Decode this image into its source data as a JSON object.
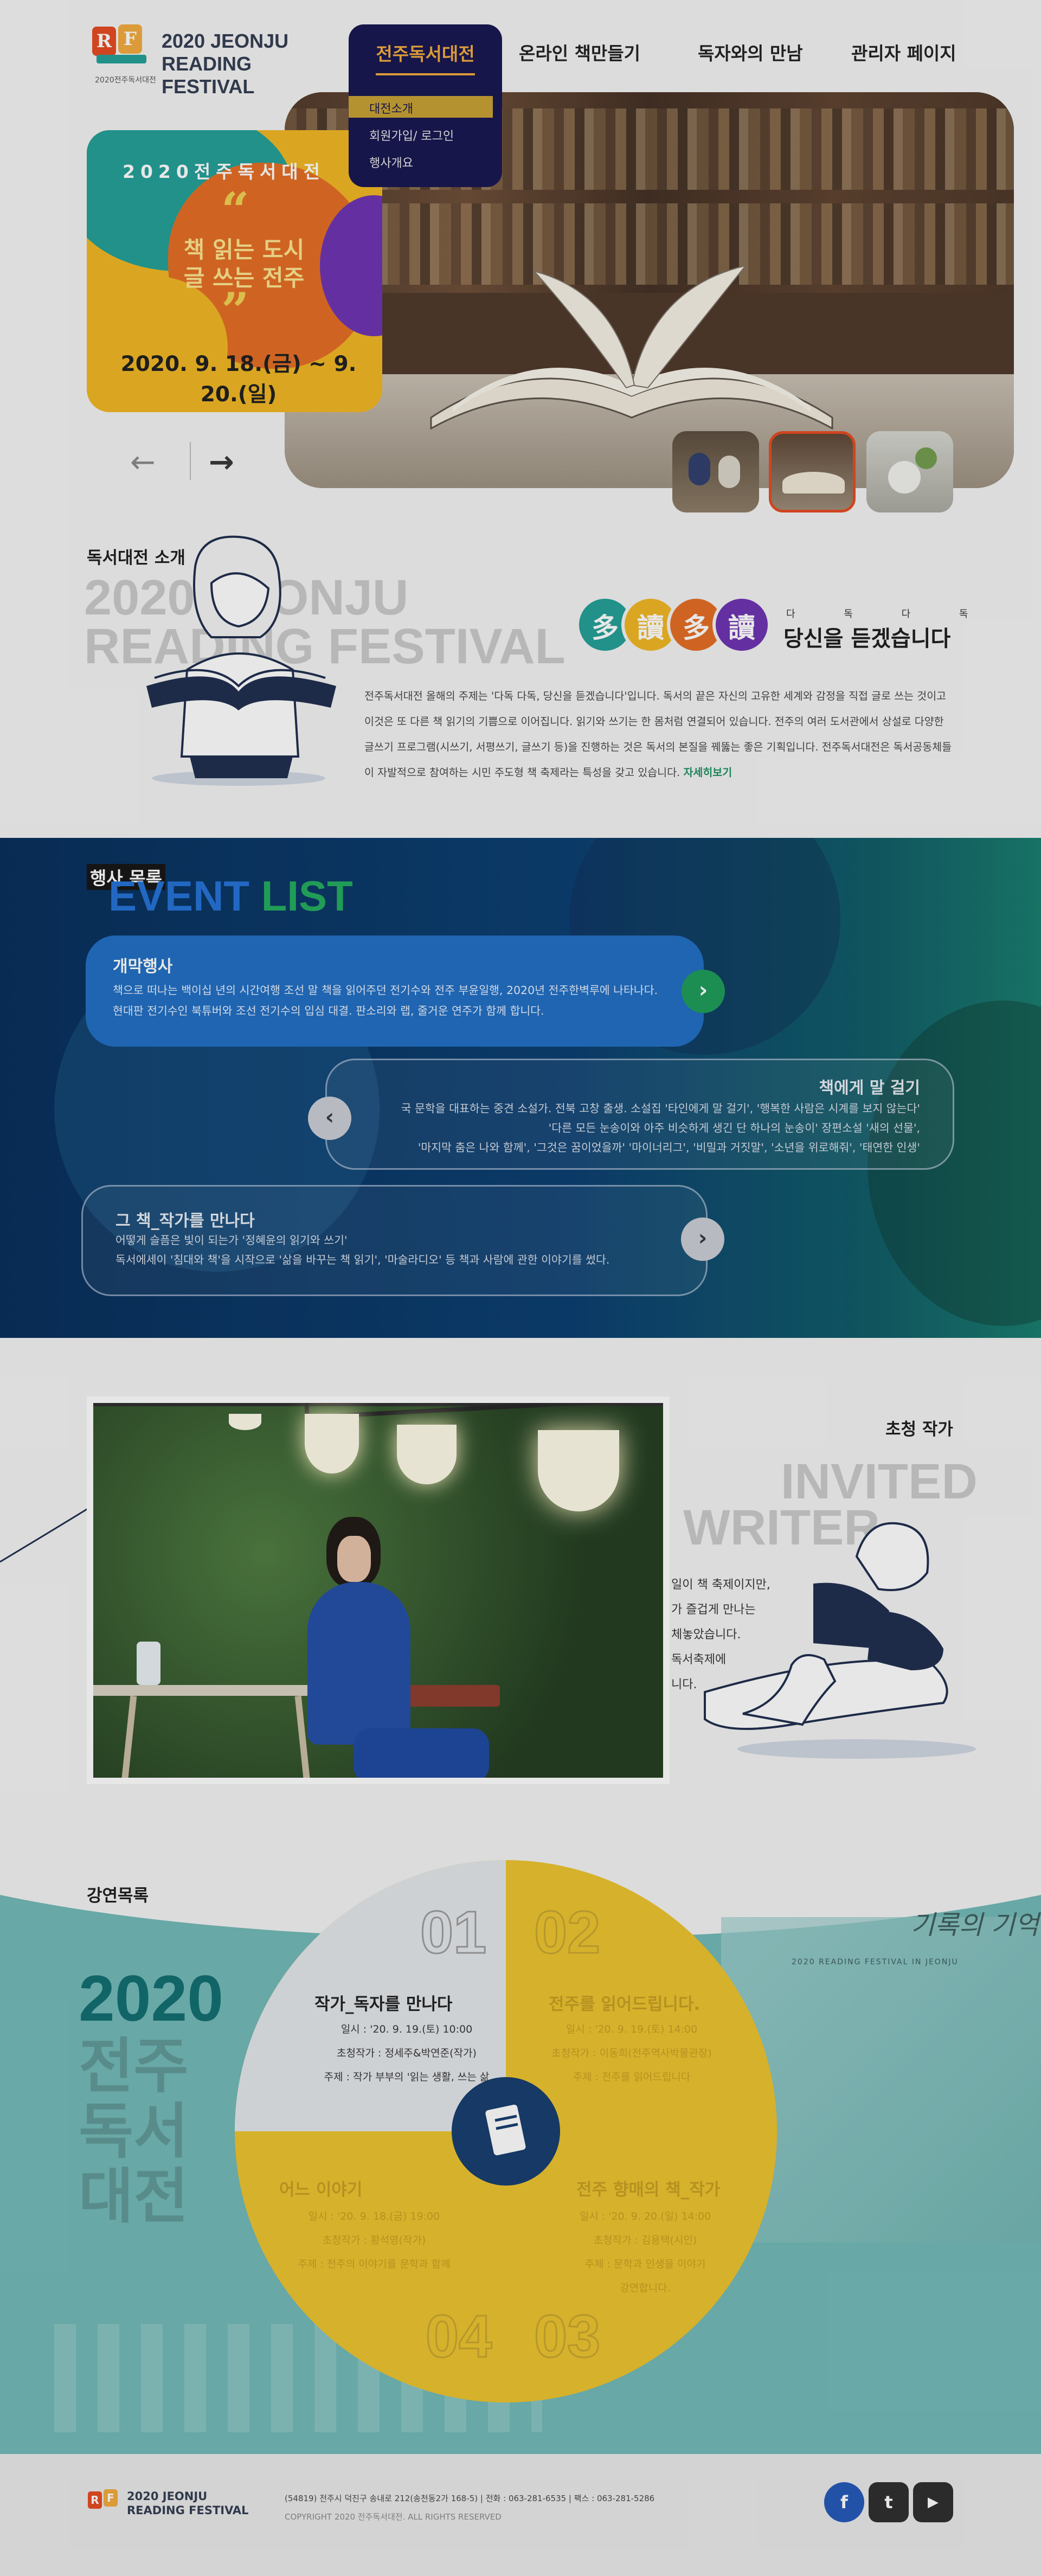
{
  "header": {
    "logo_line1": "2020 JEONJU",
    "logo_line2": "READING FESTIVAL",
    "logo_caption": "2020전주독서대전",
    "nav": [
      "전주독서대전",
      "온라인 책만들기",
      "독자와의 만남",
      "관리자 페이지"
    ],
    "dropdown": [
      "대전소개",
      "회원가입/ 로그인",
      "행사개요"
    ]
  },
  "hero": {
    "subtitle": "2020전주독서대전",
    "title_line1": "책 읽는 도시",
    "title_line2": "글 쓰는 전주",
    "date": "2020. 9. 18.(금) ~ 9. 20.(일)",
    "prev": "←",
    "next": "→"
  },
  "about": {
    "label": "독서대전 소개",
    "ghost1": "2020 JEONJU",
    "ghost2": "READING FESTIVAL",
    "chars": [
      "多",
      "讀",
      "多",
      "讀"
    ],
    "small_caps": "다 독 다 독",
    "slogan": "당신을 듣겠습니다",
    "body": "전주독서대전 올해의 주제는 '다독 다독, 당신을 듣겠습니다'입니다. 독서의 끝은 자신의 고유한 세계와 감정을 직접 글로 쓰는 것이고 이것은 또 다른 책 읽기의 기쁨으로 이어집니다. 읽기와 쓰기는 한 몸처럼 연결되어 있습니다. 전주의 여러 도서관에서 상설로 다양한 글쓰기 프로그램(시쓰기, 서평쓰기, 글쓰기 등)을 진행하는 것은 독서의 본질을 꿰뚫는 좋은 기획입니다. 전주독서대전은 독서공동체들이 자발적으로 참여하는 시민 주도형 책 축제라는 특성을 갖고 있습니다.",
    "more": "자세히보기"
  },
  "event": {
    "tag": "행사 목록",
    "big1": "EVENT",
    "big2": "LIST",
    "cards": [
      {
        "title": "개막행사",
        "text1": "책으로 떠나는 백이십 년의 시간여행 조선 말 책을 읽어주던 전기수와 전주 부윤일행, 2020년 전주한벽루에 나타나다.",
        "text2": "현대판 전기수인 북튜버와 조선 전기수의 입심 대결. 판소리와 랩, 줄거운 연주가 함께 합니다.",
        "btn": "›"
      },
      {
        "title": "책에게 말 걸기",
        "text1": "국 문학을 대표하는 중견 소설가. 전북 고창 출생. 소설집 '타인에게 말 걸기', '행복한 사람은 시계를 보지 않는다'",
        "text2": "'다른 모든 눈송이와 아주 비슷하게 생긴 단 하나의 눈송이' 장편소설 '새의 선물',",
        "text3": "'마지막 춤은 나와 함께', '그것은 꿈이었을까' '마이너리그', '비밀과 거짓말', '소년을 위로해줘', '태연한 인생'",
        "btn": "‹"
      },
      {
        "title": "그 책_작가를 만나다",
        "text1": "어떻게 슬픔은 빛이 되는가 '정혜윤의 읽기와 쓰기'",
        "text2": "독서에세이 '침대와 책'을 시작으로 '삶을 바꾸는 책 읽기', '마술라디오' 등 책과 사람에 관한 이야기를 썼다.",
        "btn": "›"
      }
    ]
  },
  "invited": {
    "label": "초청 작가",
    "ghost1": "INVITED",
    "ghost2": "WRITER",
    "lines": [
      "일이 책 축제이지만,",
      "가 즐겁게 만나는",
      "체놓았습니다.",
      "독서축제에",
      "니다."
    ]
  },
  "lectures": {
    "label": "강연목록",
    "year": "2020",
    "kor": [
      "전주",
      "독서",
      "대전"
    ],
    "items": [
      {
        "num": "01",
        "title": "작가_독자를 만나다",
        "lines": [
          "일시 : '20. 9. 19.(토) 10:00",
          "초청작가 : 정세주&박연준(작가)",
          "주제 : 작가 부부의 '읽는 생활, 쓰는 삶"
        ]
      },
      {
        "num": "02",
        "title": "전주를 읽어드립니다.",
        "lines": [
          "일시 : '20. 9. 19.(토) 14:00",
          "초청작가 : 이동희(전주역사박물관장)",
          "주제 : 전주를 읽어드립니다"
        ]
      },
      {
        "num": "03",
        "title": "전주 향매의 책_작가",
        "lines": [
          "일시 : '20. 9. 20.(일) 14:00",
          "초청작가 : 김용택(시인)",
          "주제 : 문학과 인생을 이야기",
          "강연합니다."
        ]
      },
      {
        "num": "04",
        "title": "어느 이야기",
        "lines": [
          "일시 : '20. 9. 18.(금) 19:00",
          "초청작가 : 황석영(작가)",
          "주제 : 전주의 이야기를 문학과 함께"
        ]
      }
    ],
    "watermark": "기록의 기억",
    "watermark_sub": "2020 READING FESTIVAL IN JEONJU"
  },
  "footer": {
    "logo_line1": "2020 JEONJU",
    "logo_line2": "READING FESTIVAL",
    "address": "(54819) 전주시 덕진구 송내로 212(송천동2가 168-5) | 전화 : 063-281-6535 | 팩스 : 063-281-5286",
    "copyright": "COPYRIGHT 2020 전주독서대전. ALL RIGHTS RESERVED",
    "sns": [
      "f",
      "t",
      "▶"
    ]
  },
  "colors": {
    "accent_orange": "#e5471d",
    "navy": "#13124d",
    "gold": "#f2a93a",
    "teal": "#1e9e96",
    "pie_yellow": "#ecc22a"
  }
}
